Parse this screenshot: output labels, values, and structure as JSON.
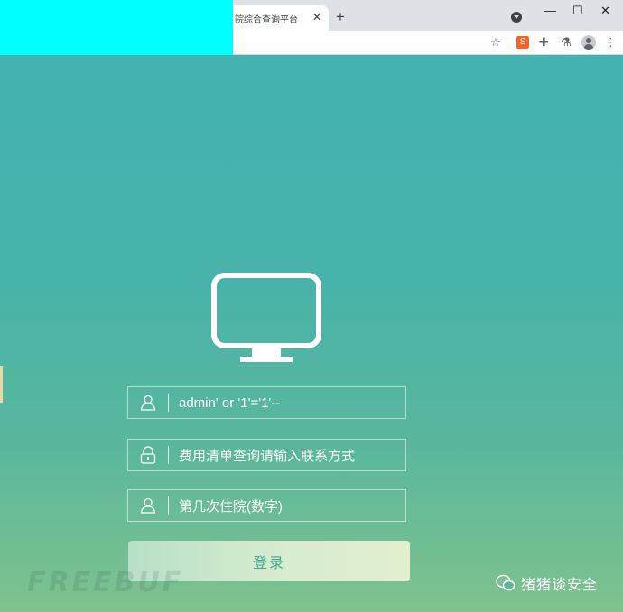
{
  "browser": {
    "tab_title": "院综合查询平台",
    "tab_close": "✕",
    "new_tab": "+",
    "minimize": "—",
    "maximize": "☐",
    "close": "✕",
    "toolbar_icons": [
      "star-icon",
      "extension-red-icon",
      "puzzle-icon",
      "flask-icon",
      "profile-avatar",
      "more-menu-icon"
    ],
    "star": "☆",
    "puzzle": "✚",
    "flask": "⚗",
    "more": "⋮",
    "ext_label": "S"
  },
  "login": {
    "username_value": "admin' or '1'='1'--",
    "password_placeholder": "费用清单查询请输入联系方式",
    "visit_placeholder": "第几次住院(数字)",
    "submit_label": "登录"
  },
  "watermarks": {
    "left": "FREEBUF",
    "right": "猪猪谈安全"
  },
  "colors": {
    "page_top": "#43b2b0",
    "page_bottom": "#7fc28e",
    "button_text": "#3faa8f",
    "cyan_block": "#00ffff"
  }
}
